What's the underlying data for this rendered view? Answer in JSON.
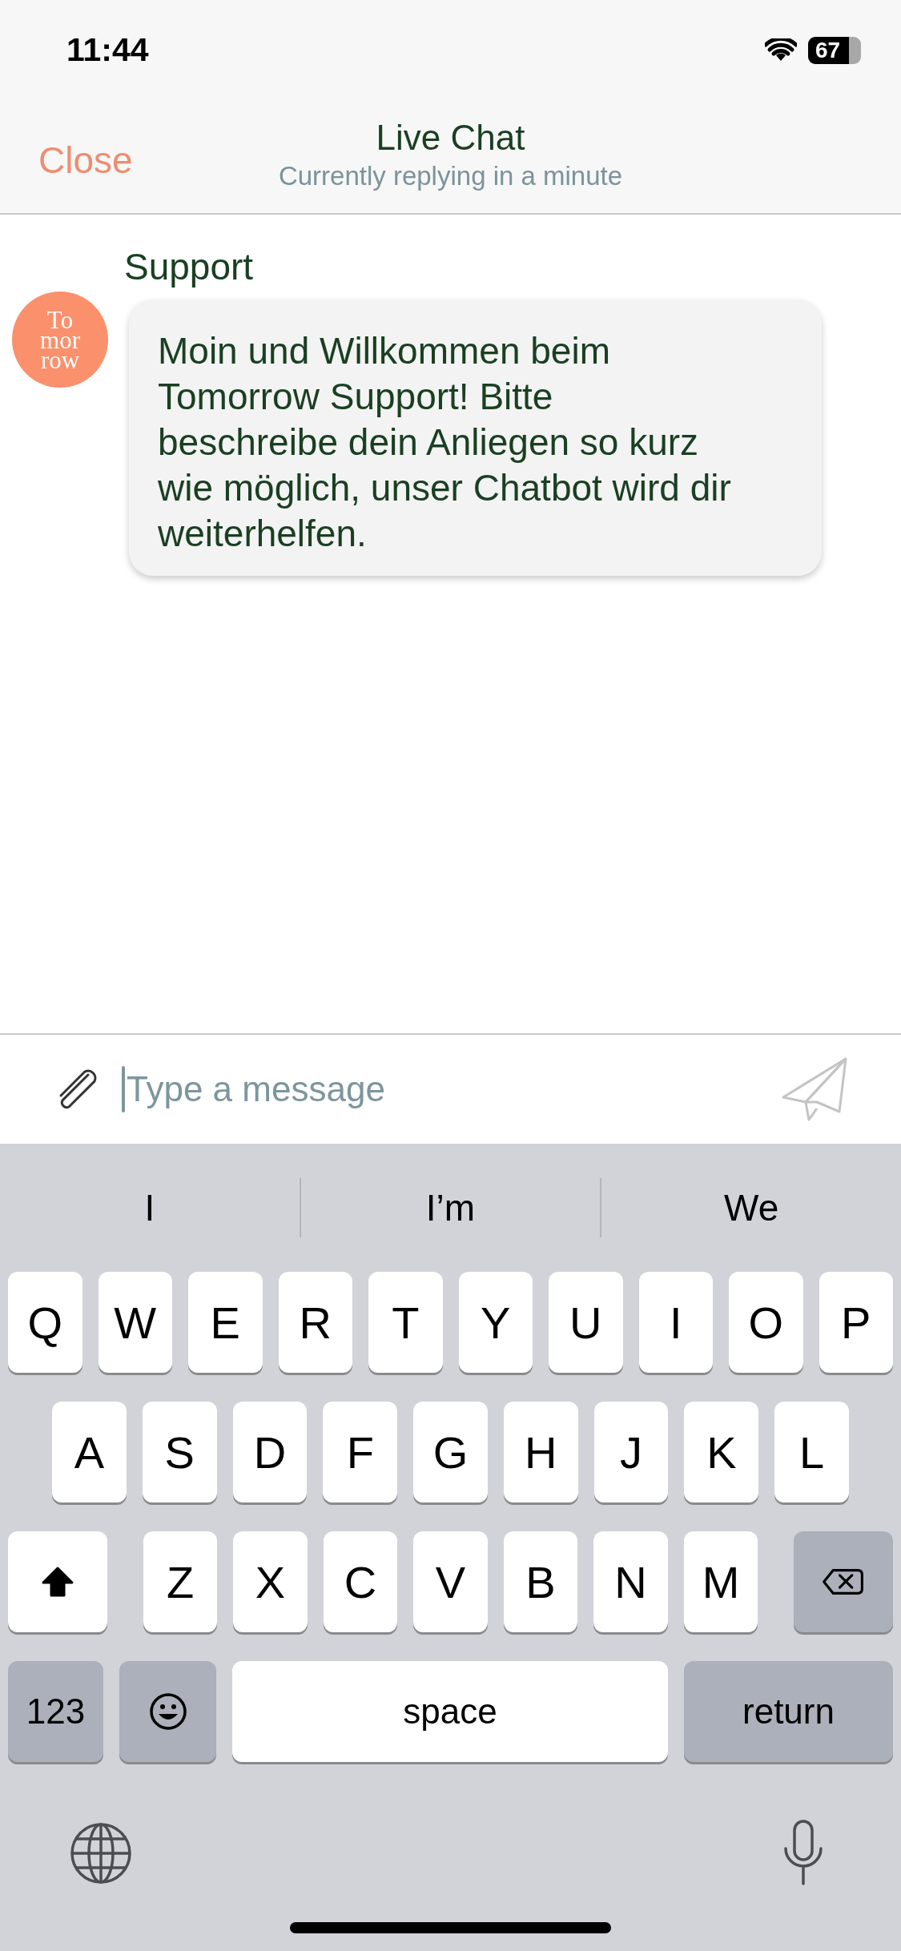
{
  "status_bar": {
    "time": "11:44",
    "battery": "67"
  },
  "header": {
    "close": "Close",
    "title": "Live Chat",
    "subtitle": "Currently replying in a minute"
  },
  "messages": [
    {
      "sender": "Support",
      "avatar": [
        "To",
        "mor",
        "row"
      ],
      "text": "Moin und Willkommen beim Tomorrow Support! Bitte beschreibe dein Anliegen so kurz wie möglich, unser Chatbot wird dir weiterhelfen."
    }
  ],
  "composer": {
    "placeholder": "Type a message"
  },
  "keyboard": {
    "suggestions": [
      "I",
      "I’m",
      "We"
    ],
    "rows": [
      {
        "keys": [
          {
            "kind": "letter",
            "label": "Q"
          },
          {
            "kind": "letter",
            "label": "W"
          },
          {
            "kind": "letter",
            "label": "E"
          },
          {
            "kind": "letter",
            "label": "R"
          },
          {
            "kind": "letter",
            "label": "T"
          },
          {
            "kind": "letter",
            "label": "Y"
          },
          {
            "kind": "letter",
            "label": "U"
          },
          {
            "kind": "letter",
            "label": "I"
          },
          {
            "kind": "letter",
            "label": "O"
          },
          {
            "kind": "letter",
            "label": "P"
          }
        ]
      },
      {
        "keys": [
          {
            "kind": "letter",
            "label": "A"
          },
          {
            "kind": "letter",
            "label": "S"
          },
          {
            "kind": "letter",
            "label": "D"
          },
          {
            "kind": "letter",
            "label": "F"
          },
          {
            "kind": "letter",
            "label": "G"
          },
          {
            "kind": "letter",
            "label": "H"
          },
          {
            "kind": "letter",
            "label": "J"
          },
          {
            "kind": "letter",
            "label": "K"
          },
          {
            "kind": "letter",
            "label": "L"
          }
        ]
      },
      {
        "keys": [
          {
            "kind": "shift",
            "on": true
          },
          {
            "kind": "letter",
            "label": "Z"
          },
          {
            "kind": "letter",
            "label": "X"
          },
          {
            "kind": "letter",
            "label": "C"
          },
          {
            "kind": "letter",
            "label": "V"
          },
          {
            "kind": "letter",
            "label": "B"
          },
          {
            "kind": "letter",
            "label": "N"
          },
          {
            "kind": "letter",
            "label": "M"
          },
          {
            "kind": "delete"
          }
        ]
      },
      {
        "keys": [
          {
            "kind": "numbers",
            "label": "123"
          },
          {
            "kind": "emoji"
          },
          {
            "kind": "space",
            "label": "space"
          },
          {
            "kind": "return",
            "label": "return"
          }
        ]
      }
    ]
  }
}
